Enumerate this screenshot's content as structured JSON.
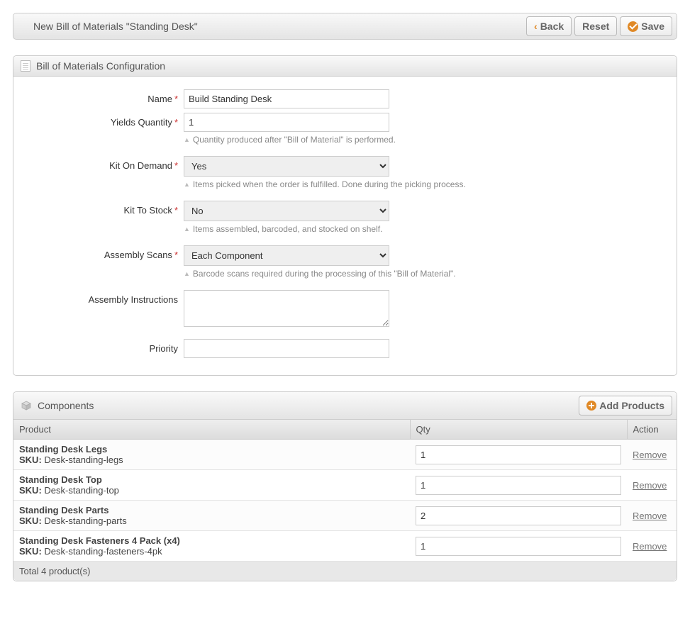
{
  "header": {
    "title": "New Bill of Materials \"Standing Desk\"",
    "back": "Back",
    "reset": "Reset",
    "save": "Save"
  },
  "panel1": {
    "title": "Bill of Materials Configuration"
  },
  "form": {
    "name": {
      "label": "Name",
      "value": "Build Standing Desk"
    },
    "yields": {
      "label": "Yields Quantity",
      "value": "1",
      "help": "Quantity produced after \"Bill of Material\" is performed."
    },
    "kitDemand": {
      "label": "Kit On Demand",
      "value": "Yes",
      "help": "Items picked when the order is fulfilled. Done during the picking process."
    },
    "kitStock": {
      "label": "Kit To Stock",
      "value": "No",
      "help": "Items assembled, barcoded, and stocked on shelf."
    },
    "scans": {
      "label": "Assembly Scans",
      "value": "Each Component",
      "help": "Barcode scans required during the processing of this \"Bill of Material\"."
    },
    "instructions": {
      "label": "Assembly Instructions",
      "value": ""
    },
    "priority": {
      "label": "Priority",
      "value": ""
    }
  },
  "components": {
    "title": "Components",
    "addBtn": "Add Products",
    "columns": {
      "product": "Product",
      "qty": "Qty",
      "action": "Action"
    },
    "skuLabel": "SKU:",
    "removeLabel": "Remove",
    "rows": [
      {
        "name": "Standing Desk Legs",
        "sku": "Desk-standing-legs",
        "qty": "1"
      },
      {
        "name": "Standing Desk Top",
        "sku": "Desk-standing-top",
        "qty": "1"
      },
      {
        "name": "Standing Desk Parts",
        "sku": "Desk-standing-parts",
        "qty": "2"
      },
      {
        "name": "Standing Desk Fasteners 4 Pack (x4)",
        "sku": "Desk-standing-fasteners-4pk",
        "qty": "1"
      }
    ],
    "footer": "Total 4 product(s)"
  }
}
